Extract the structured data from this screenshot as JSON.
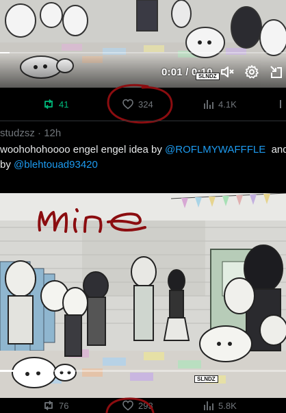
{
  "post1": {
    "video": {
      "time": "0:01 / 0:10",
      "watermark": "SLNDZ"
    },
    "actions": {
      "reposts": "41",
      "likes": "324",
      "views": "4.1K"
    }
  },
  "post2": {
    "author_handle": "studzsz",
    "separator": "·",
    "time_ago": "12h",
    "text_line1_prefix": "woohohohoooo engel engel idea by ",
    "mention1": "@ROFLMYWAFFFLE",
    "text_line1_suffix": "  and",
    "text_line2_prefix": "by ",
    "mention2": "@blehtouad93420",
    "video": {
      "annotation": "mine",
      "watermark": "SLNDZ"
    },
    "actions": {
      "reposts": "76",
      "likes": "293",
      "views": "5.8K"
    }
  },
  "colors": {
    "background": "#000000",
    "text": "#e7e9ea",
    "muted": "#71767b",
    "link": "#1d9bf0",
    "repost_active": "#00ba7c",
    "annotation_red": "#8b0d10"
  },
  "icons": [
    "volume-muted-icon",
    "settings-gear-icon",
    "fullscreen-exit-icon",
    "repost-icon",
    "heart-icon",
    "views-chart-icon",
    "share-icon"
  ]
}
